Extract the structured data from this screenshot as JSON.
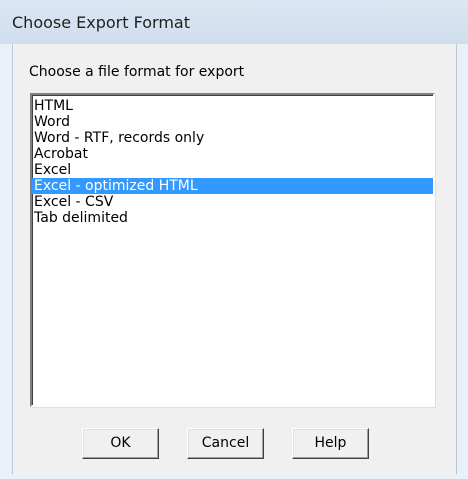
{
  "window": {
    "title": "Choose Export Format"
  },
  "dialog": {
    "prompt": "Choose a file format for export",
    "formats": [
      "HTML",
      "Word",
      "Word - RTF, records only",
      "Acrobat",
      "Excel",
      "Excel - optimized HTML",
      "Excel - CSV",
      "Tab delimited"
    ],
    "selected_format": "Excel - optimized HTML"
  },
  "buttons": {
    "ok": "OK",
    "cancel": "Cancel",
    "help": "Help"
  },
  "colors": {
    "selection": "#3399ff",
    "title_bar": "#cfdded"
  }
}
